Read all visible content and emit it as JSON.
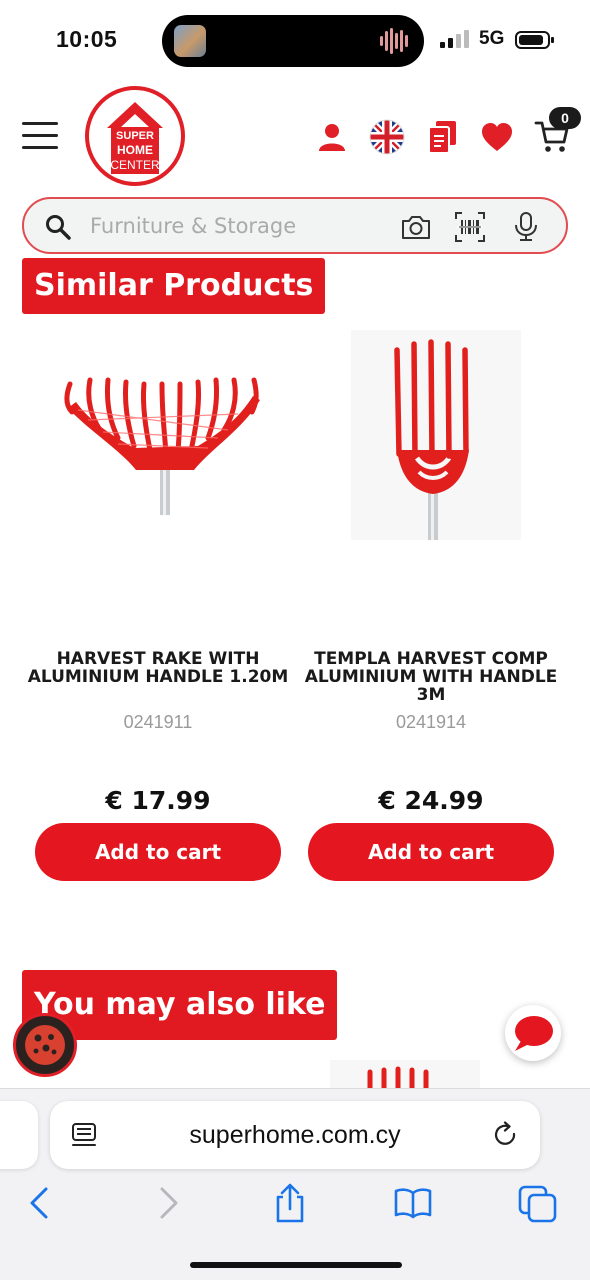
{
  "status_bar": {
    "time": "10:05",
    "network": "5G",
    "icons": [
      "signal-icon",
      "battery-icon"
    ]
  },
  "header": {
    "logo": {
      "line1": "SUPER",
      "line2": "HOME",
      "line3": "CENTER"
    },
    "icons": [
      "menu-icon",
      "account-icon",
      "uk-flag-icon",
      "catalog-icon",
      "wishlist-heart-icon",
      "cart-icon"
    ],
    "cart_count": "0",
    "brand_color": "#e01f26"
  },
  "search": {
    "placeholder": "Furniture & Storage",
    "tools": [
      "camera-icon",
      "barcode-scanner-icon",
      "microphone-icon"
    ]
  },
  "similar": {
    "heading": "Similar Products",
    "products": [
      {
        "name": "HARVEST RAKE WITH ALUMINIUM HANDLE 1.20M",
        "sku": "0241911",
        "price": "€ 17.99",
        "button": "Add to cart"
      },
      {
        "name": "TEMPLA HARVEST COMP ALUMINIUM WITH HANDLE 3M",
        "sku": "0241914",
        "price": "€ 24.99",
        "button": "Add to cart"
      }
    ]
  },
  "also_like": {
    "heading": "You may also like"
  },
  "browser": {
    "url": "superhome.com.cy",
    "toolbar": [
      "back-icon",
      "forward-icon",
      "share-icon",
      "bookmarks-icon",
      "tabs-icon"
    ]
  }
}
